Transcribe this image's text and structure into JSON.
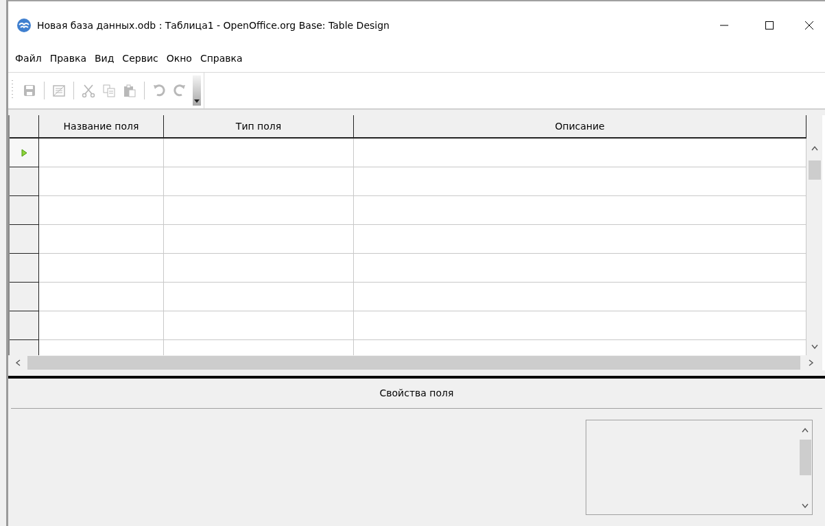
{
  "window": {
    "title": "Новая база данных.odb : Таблица1 - OpenOffice.org Base: Table Design"
  },
  "menu": [
    "Файл",
    "Правка",
    "Вид",
    "Сервис",
    "Окно",
    "Справка"
  ],
  "toolbar": [
    {
      "kind": "save",
      "disabled": true
    },
    {
      "kind": "sep"
    },
    {
      "kind": "index",
      "disabled": true
    },
    {
      "kind": "sep"
    },
    {
      "kind": "cut",
      "disabled": true
    },
    {
      "kind": "copy",
      "disabled": true
    },
    {
      "kind": "paste",
      "disabled": true
    },
    {
      "kind": "sep"
    },
    {
      "kind": "undo",
      "disabled": true
    },
    {
      "kind": "redo",
      "disabled": true
    }
  ],
  "table": {
    "columns": [
      "Название поля",
      "Тип поля",
      "Описание"
    ],
    "rows": [
      {
        "selected": true
      },
      {
        "selected": false
      },
      {
        "selected": false
      },
      {
        "selected": false
      },
      {
        "selected": false
      },
      {
        "selected": false
      },
      {
        "selected": false
      },
      {
        "selected": false
      }
    ]
  },
  "properties": {
    "title": "Свойства поля"
  }
}
